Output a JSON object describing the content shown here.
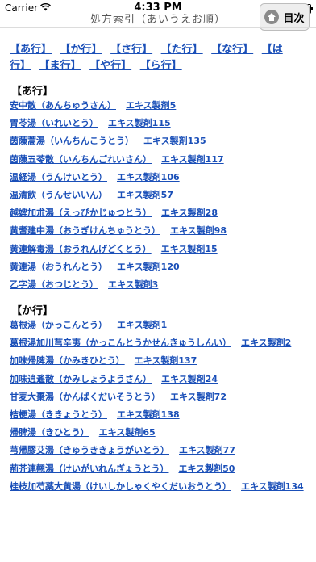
{
  "status_bar": {
    "carrier": "Carrier",
    "time": "4:33 PM"
  },
  "nav": {
    "title": "処方索引（あいうえお順）",
    "toc_button_label": "目次"
  },
  "index_nav": [
    "【あ行】",
    "【か行】",
    "【さ行】",
    "【た行】",
    "【な行】",
    "【は行】",
    "【ま行】",
    "【や行】",
    "【ら行】"
  ],
  "sections": [
    {
      "header": "【あ行】",
      "entries": [
        {
          "name": "安中散（あんちゅうさん）",
          "code": "エキス製剤5"
        },
        {
          "name": "胃苓湯（いれいとう）",
          "code": "エキス製剤115"
        },
        {
          "name": "茵蔯蒿湯（いんちんこうとう）",
          "code": "エキス製剤135"
        },
        {
          "name": "茵蔯五苓散（いんちんごれいさん）",
          "code": "エキス製剤117"
        },
        {
          "name": "温経湯（うんけいとう）",
          "code": "エキス製剤106"
        },
        {
          "name": "温清飲（うんせいいん）",
          "code": "エキス製剤57"
        },
        {
          "name": "越婢加朮湯（えっぴかじゅつとう）",
          "code": "エキス製剤28"
        },
        {
          "name": "黄耆建中湯（おうぎけんちゅうとう）",
          "code": "エキス製剤98"
        },
        {
          "name": "黄連解毒湯（おうれんげどくとう）",
          "code": "エキス製剤15"
        },
        {
          "name": "黄連湯（おうれんとう）",
          "code": "エキス製剤120"
        },
        {
          "name": "乙字湯（おつじとう）",
          "code": "エキス製剤3"
        }
      ]
    },
    {
      "header": "【か行】",
      "entries": [
        {
          "name": "葛根湯（かっこんとう）",
          "code": "エキス製剤1"
        },
        {
          "name": "葛根湯加川芎辛夷（かっこんとうかせんきゅうしんい）",
          "code": "エキス製剤2"
        },
        {
          "name": "加味帰脾湯（かみきひとう）",
          "code": "エキス製剤137"
        },
        {
          "name": "加味逍遙散（かみしょうようさん）",
          "code": "エキス製剤24"
        },
        {
          "name": "甘麦大棗湯（かんばくだいそうとう）",
          "code": "エキス製剤72"
        },
        {
          "name": "桔梗湯（ききょうとう）",
          "code": "エキス製剤138"
        },
        {
          "name": "帰脾湯（きひとう）",
          "code": "エキス製剤65"
        },
        {
          "name": "芎帰膠艾湯（きゅうききょうがいとう）",
          "code": "エキス製剤77"
        },
        {
          "name": "荊芥連翹湯（けいがいれんぎょうとう）",
          "code": "エキス製剤50"
        },
        {
          "name": "桂枝加芍薬大黄湯（けいしかしゃくやくだいおうとう）",
          "code": "エキス製剤134"
        }
      ]
    }
  ]
}
